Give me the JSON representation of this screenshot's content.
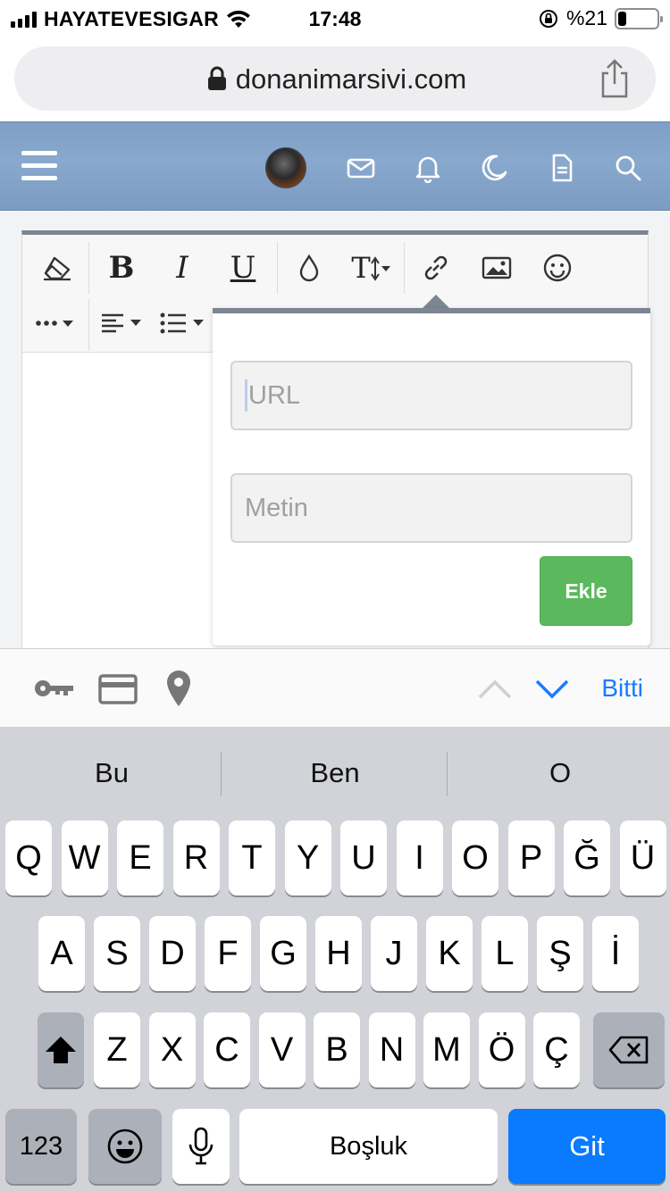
{
  "status_bar": {
    "carrier": "HAYATEVESIGAR",
    "time": "17:48",
    "battery_text": "%21",
    "battery_level": 0.21
  },
  "browser": {
    "url": "donanimarsivi.com"
  },
  "popup": {
    "url_placeholder": "URL",
    "text_placeholder": "Metin",
    "add_label": "Ekle"
  },
  "accessory": {
    "done_label": "Bitti"
  },
  "keyboard": {
    "suggestions": [
      "Bu",
      "Ben",
      "O"
    ],
    "row1": [
      "Q",
      "W",
      "E",
      "R",
      "T",
      "Y",
      "U",
      "I",
      "O",
      "P",
      "Ğ",
      "Ü"
    ],
    "row2": [
      "A",
      "S",
      "D",
      "F",
      "G",
      "H",
      "J",
      "K",
      "L",
      "Ş",
      "İ"
    ],
    "row3": [
      "Z",
      "X",
      "C",
      "V",
      "B",
      "N",
      "M",
      "Ö",
      "Ç"
    ],
    "numbers_label": "123",
    "space_label": "Boşluk",
    "go_label": "Git"
  },
  "colors": {
    "header": "#7f9fc6",
    "go_key": "#0a7aff",
    "add_button": "#5cb85c",
    "done_link": "#1a7bff"
  }
}
